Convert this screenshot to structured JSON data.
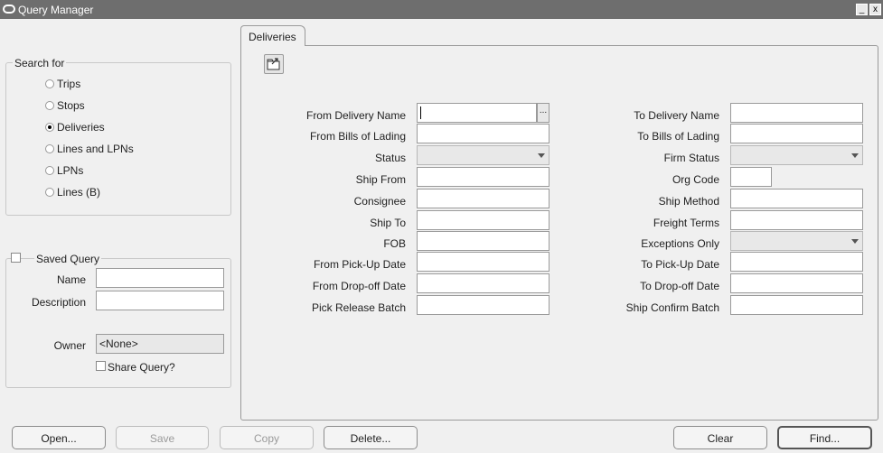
{
  "window": {
    "title": "Query Manager",
    "minimize": "_",
    "close": "x"
  },
  "search_for": {
    "label": "Search for",
    "options": [
      {
        "label": "Trips",
        "selected": false
      },
      {
        "label": "Stops",
        "selected": false
      },
      {
        "label": "Deliveries",
        "selected": true
      },
      {
        "label": "Lines and LPNs",
        "selected": false
      },
      {
        "label": "LPNs",
        "selected": false
      },
      {
        "label": "Lines (B)",
        "selected": false
      }
    ]
  },
  "saved_query": {
    "label": "Saved Query",
    "checked": false,
    "name_label": "Name",
    "name_value": "",
    "description_label": "Description",
    "description_value": "",
    "owner_label": "Owner",
    "owner_value": "<None>",
    "share_label": "Share Query?",
    "share_checked": false
  },
  "tab": {
    "label": "Deliveries"
  },
  "form": {
    "left": [
      {
        "label": "From Delivery Name",
        "type": "lov",
        "value": ""
      },
      {
        "label": "From Bills of Lading",
        "type": "text",
        "value": ""
      },
      {
        "label": "Status",
        "type": "combo",
        "value": ""
      },
      {
        "label": "Ship From",
        "type": "text",
        "value": ""
      },
      {
        "label": "Consignee",
        "type": "text",
        "value": ""
      },
      {
        "label": "Ship To",
        "type": "text",
        "value": ""
      },
      {
        "label": "FOB",
        "type": "text",
        "value": ""
      },
      {
        "label": "From Pick-Up Date",
        "type": "text",
        "value": ""
      },
      {
        "label": "From Drop-off Date",
        "type": "text",
        "value": ""
      },
      {
        "label": "Pick Release Batch",
        "type": "text",
        "value": ""
      }
    ],
    "right": [
      {
        "label": "To Delivery Name",
        "type": "text",
        "value": ""
      },
      {
        "label": "To Bills of Lading",
        "type": "text",
        "value": ""
      },
      {
        "label": "Firm Status",
        "type": "combo",
        "value": ""
      },
      {
        "label": "Org Code",
        "type": "short",
        "value": ""
      },
      {
        "label": "Ship Method",
        "type": "text",
        "value": ""
      },
      {
        "label": "Freight Terms",
        "type": "text",
        "value": ""
      },
      {
        "label": "Exceptions Only",
        "type": "combo",
        "value": ""
      },
      {
        "label": "To Pick-Up Date",
        "type": "text",
        "value": ""
      },
      {
        "label": "To Drop-off Date",
        "type": "text",
        "value": ""
      },
      {
        "label": "Ship Confirm Batch",
        "type": "text",
        "value": ""
      }
    ],
    "lov_button": "..."
  },
  "buttons": {
    "open": "Open...",
    "save": "Save",
    "copy": "Copy",
    "delete": "Delete...",
    "clear": "Clear",
    "find": "Find..."
  }
}
